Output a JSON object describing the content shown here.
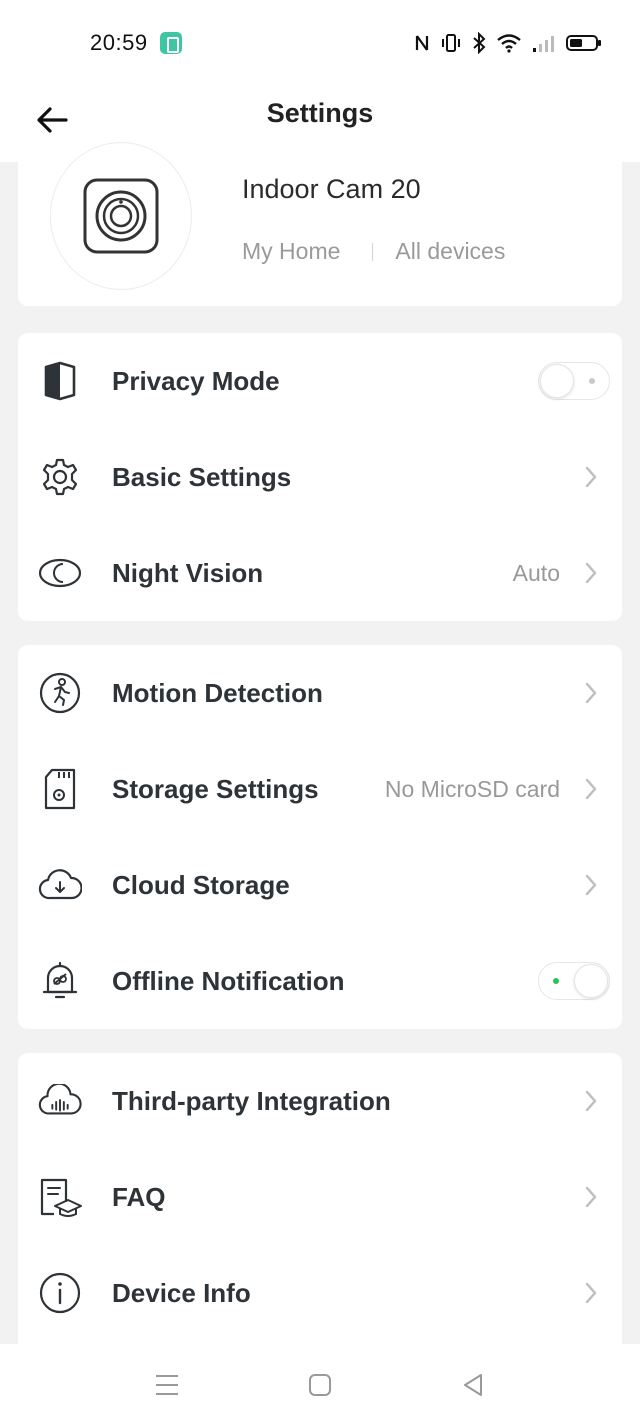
{
  "status_bar": {
    "time": "20:59",
    "icons": [
      "app-icon",
      "nfc-icon",
      "vibrate-icon",
      "bluetooth-icon",
      "wifi-icon",
      "signal-icon",
      "battery-icon"
    ]
  },
  "header": {
    "title": "Settings",
    "back_icon": "arrow-left-icon"
  },
  "device": {
    "name": "Indoor Cam 20",
    "home": "My Home",
    "room": "All devices",
    "icon": "camera-icon"
  },
  "groups": [
    {
      "items": [
        {
          "label": "Privacy Mode",
          "icon": "half-shield-icon",
          "control": "toggle",
          "on": false
        },
        {
          "label": "Basic Settings",
          "icon": "gear-icon",
          "control": "chevron"
        },
        {
          "label": "Night Vision",
          "icon": "moon-eye-icon",
          "value": "Auto",
          "control": "chevron"
        }
      ]
    },
    {
      "items": [
        {
          "label": "Motion Detection",
          "icon": "running-person-icon",
          "control": "chevron"
        },
        {
          "label": "Storage Settings",
          "icon": "sd-card-icon",
          "value": "No MicroSD card",
          "control": "chevron"
        },
        {
          "label": "Cloud Storage",
          "icon": "cloud-icon",
          "control": "chevron"
        },
        {
          "label": "Offline Notification",
          "icon": "bell-icon",
          "control": "toggle",
          "on": true
        }
      ]
    },
    {
      "items": [
        {
          "label": "Third-party Integration",
          "icon": "cloud-sound-icon",
          "control": "chevron"
        },
        {
          "label": "FAQ",
          "icon": "faq-icon",
          "control": "chevron"
        },
        {
          "label": "Device Info",
          "icon": "info-icon",
          "control": "chevron"
        }
      ]
    }
  ],
  "colors": {
    "toggle_on_dot": "#2bc25c",
    "background": "#f2f2f2"
  },
  "nav_bar": [
    "menu-icon",
    "home-square-icon",
    "back-triangle-icon"
  ]
}
